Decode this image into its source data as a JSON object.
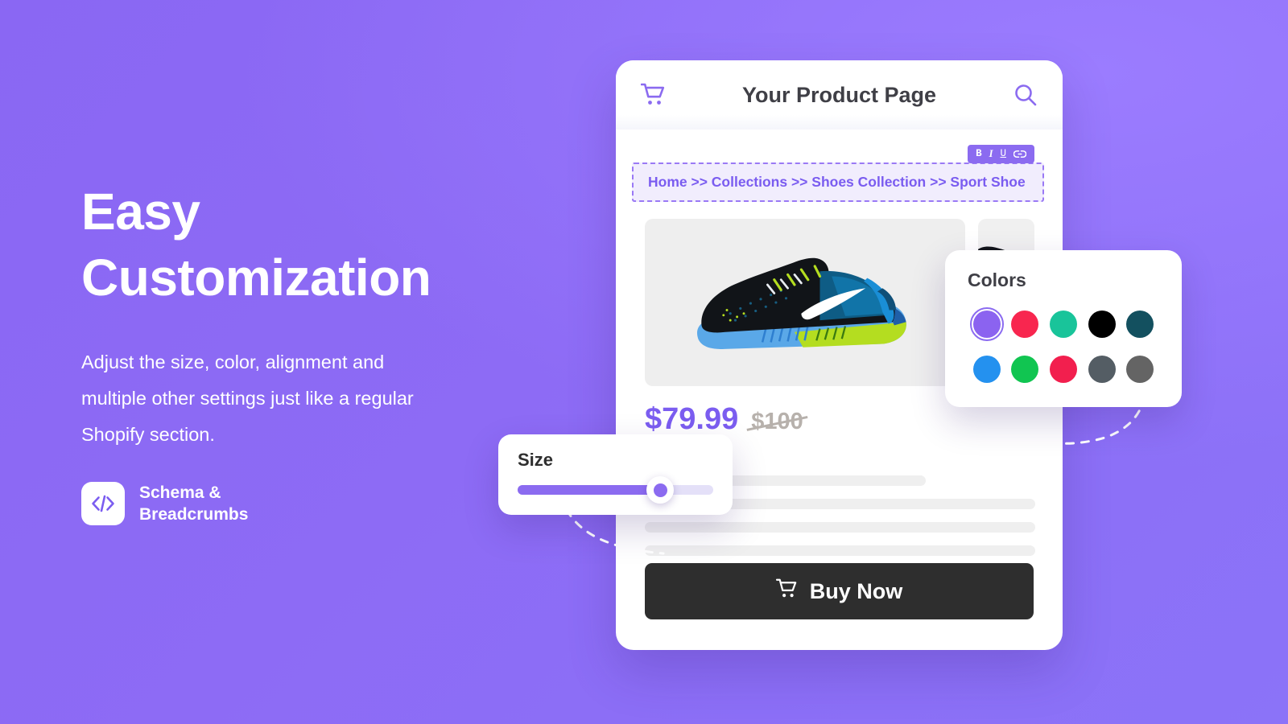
{
  "background": {
    "gradient_from": "#8a67f3",
    "gradient_to": "#8b73f8"
  },
  "hero": {
    "headline": "Easy\nCustomization",
    "body": "Adjust the size, color, alignment and multiple other settings just like a regular Shopify section.",
    "badge": {
      "icon": "code-icon",
      "label": "Schema &\nBreadcrumbs"
    }
  },
  "product_card": {
    "header": {
      "title": "Your Product Page",
      "cart_icon": "shopping-cart-icon",
      "search_icon": "search-icon"
    },
    "rich_text_toolbar": {
      "bold": "B",
      "italic": "I",
      "underline": "U",
      "link_icon": "link-icon"
    },
    "breadcrumb": "Home >> Collections  >> Shoes Collection  >> Sport Shoe",
    "gallery": {
      "main_alt": "sport-shoe-main-image",
      "thumb_alt": "sport-shoe-thumbnail"
    },
    "price": {
      "current": "$79.99",
      "original": "$100"
    },
    "buy_button": {
      "label": "Buy Now",
      "icon": "shopping-cart-icon",
      "background": "#2e2e2e"
    },
    "skeleton_widths": [
      "72%",
      "100%",
      "100%",
      "100%"
    ]
  },
  "colors_panel": {
    "title": "Colors",
    "selected_index": 0,
    "swatches": [
      {
        "name": "purple",
        "hex": "#8b63f0"
      },
      {
        "name": "crimson",
        "hex": "#f8264f"
      },
      {
        "name": "teal-green",
        "hex": "#19c49a"
      },
      {
        "name": "black",
        "hex": "#000000"
      },
      {
        "name": "dark-teal",
        "hex": "#13505f"
      },
      {
        "name": "blue",
        "hex": "#2491ef"
      },
      {
        "name": "green",
        "hex": "#11c551"
      },
      {
        "name": "red",
        "hex": "#f21f4e"
      },
      {
        "name": "slate-gray",
        "hex": "#545d64"
      },
      {
        "name": "gray",
        "hex": "#646464"
      }
    ]
  },
  "size_panel": {
    "title": "Size",
    "value_percent": 73,
    "track_color": "#e4e0f8",
    "fill_color": "#8b6bf0"
  }
}
